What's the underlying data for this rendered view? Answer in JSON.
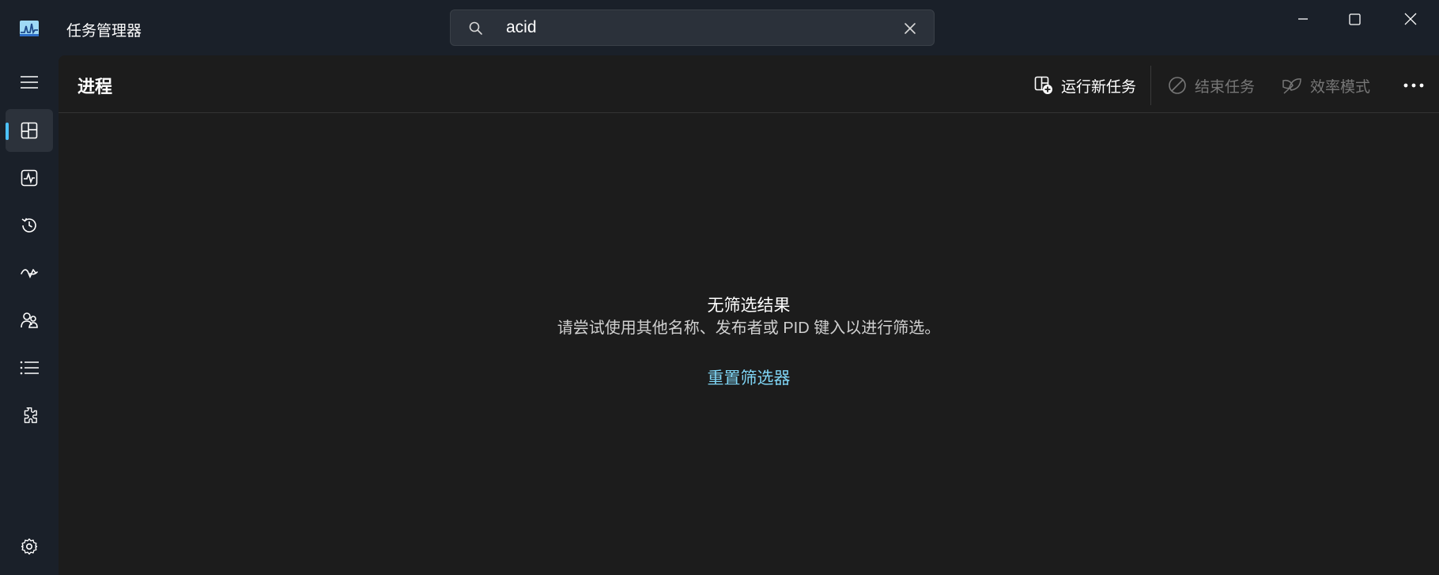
{
  "app": {
    "title": "任务管理器"
  },
  "search": {
    "value": "acid",
    "placeholder": ""
  },
  "page": {
    "title": "进程"
  },
  "toolbar": {
    "run_new_task": "运行新任务",
    "end_task": "结束任务",
    "efficiency_mode": "效率模式"
  },
  "empty_state": {
    "title": "无筛选结果",
    "description": "请尝试使用其他名称、发布者或 PID 键入以进行筛选。",
    "reset_link": "重置筛选器"
  },
  "sidebar": {
    "items": [
      {
        "name": "processes",
        "icon": "processes-icon",
        "active": true
      },
      {
        "name": "performance",
        "icon": "performance-icon"
      },
      {
        "name": "app-history",
        "icon": "history-icon"
      },
      {
        "name": "startup-apps",
        "icon": "startup-icon"
      },
      {
        "name": "users",
        "icon": "users-icon"
      },
      {
        "name": "details",
        "icon": "details-icon"
      },
      {
        "name": "services",
        "icon": "services-icon"
      }
    ],
    "settings_icon": "settings-icon"
  },
  "colors": {
    "accent": "#4cc2ff",
    "link": "#7fd5f5",
    "titlebar_bg": "#1a2029",
    "content_bg": "#1c1c1c"
  }
}
